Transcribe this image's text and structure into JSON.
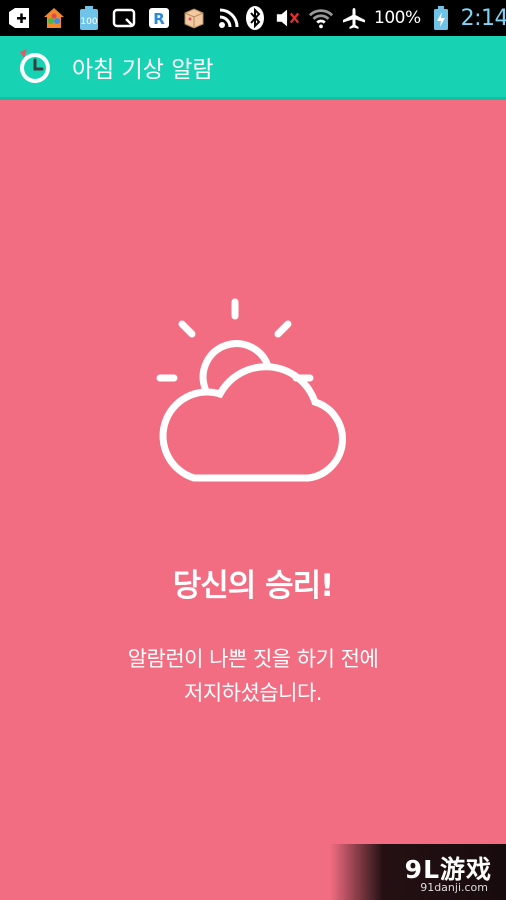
{
  "status_bar": {
    "left_icons": [
      "add-icon",
      "home-launcher-icon",
      "battery-100-icon",
      "q-app-icon",
      "r-app-icon",
      "box-app-icon",
      "rss-icon"
    ],
    "battery_100_label": "100",
    "right_icons": [
      "bluetooth-icon",
      "volume-muted-icon",
      "wifi-icon",
      "airplane-icon",
      "battery-icon"
    ],
    "battery_percent": "100%",
    "time": "2:14"
  },
  "app_bar": {
    "icon": "alarm-clock-icon",
    "title": "아침 기상 알람"
  },
  "main": {
    "icon": "partly-cloudy-icon",
    "title": "당신의 승리!",
    "message_line1": "알람런이 나쁜 짓을 하기 전에",
    "message_line2": "저지하셨습니다."
  },
  "watermark": {
    "logo_text": "9L游戏",
    "url": "91danji.com"
  },
  "colors": {
    "background": "#f26d82",
    "app_bar": "#18d2b4",
    "status_bar": "#000000",
    "clock": "#7fd3f5"
  }
}
